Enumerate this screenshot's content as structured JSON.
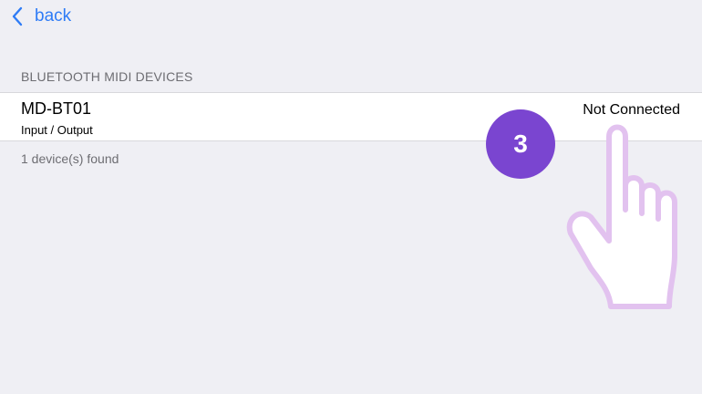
{
  "nav": {
    "back_label": "back",
    "back_icon": "chevron-left-icon"
  },
  "section": {
    "header": "BLUETOOTH MIDI DEVICES"
  },
  "device": {
    "name": "MD-BT01",
    "type": "Input / Output",
    "status": "Not Connected"
  },
  "footer": {
    "found_text": "1 device(s) found"
  },
  "overlay": {
    "step_number": "3",
    "badge_color": "#7a45d0",
    "hand_icon": "pointing-hand-icon"
  },
  "colors": {
    "accent": "#2f7cf6",
    "background": "#efeff4"
  }
}
